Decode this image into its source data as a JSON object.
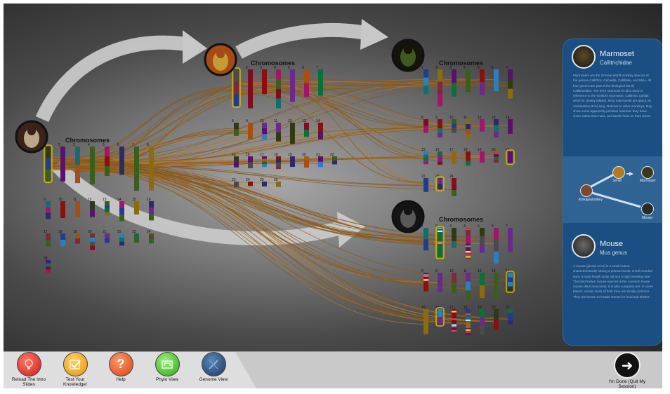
{
  "genomes": [
    {
      "id": "kw",
      "label": "Chromosomes"
    },
    {
      "id": "sw",
      "label": "Chromosomes"
    },
    {
      "id": "mm",
      "label": "Chromosomes"
    },
    {
      "id": "ms",
      "label": "Chromosomes"
    }
  ],
  "panel": {
    "marmoset": {
      "title": "Marmoset",
      "subtitle": "Callitrichidae",
      "text": "Marmosets are the 22 New World monkey species of the genera Callithrix, Cebuella, Callibella, and Mico. All four genera are part of the biological family Callitrichidae. The term marmoset is also used in reference to the Goeldi's marmoset, Callimico goeldii, which is closely related. Most marmosets are about 20 centimetres (8 in) long. Relative to other monkeys, they show some apparently primitive features: they have claws rather than nails, and tactile hairs on their wrists."
    },
    "tree": {
      "root": "Kinkajoutonkey",
      "nodes": [
        "Sirrah",
        "Marmoset",
        "Mouse"
      ]
    },
    "mouse": {
      "title": "Mouse",
      "subtitle": "Mus genus",
      "text": "A mouse (plural: mice) is a small rodent characteristically having a pointed snout, small rounded ears, a body-length scaly tail and a high breeding rate. The best known mouse species is the common house mouse (Mus musculus). It is also a popular pet. In some places, certain kinds of field mice are locally common. They are known to invade homes for food and shelter."
    }
  },
  "toolbar": {
    "reload": "Reload The Intro Slides",
    "test": "Test Your Knowledge!",
    "help": "Help",
    "phylo": "Phylo View",
    "genome": "Genome View",
    "done": "I'm Done (Quit My Session)"
  },
  "colors": {
    "stage_dark": "#262626",
    "panel": "#1b4e82",
    "link": "#8a5a1e",
    "highlight": "#d4b400",
    "reload": "#e8312f",
    "test": "#f2a50c",
    "help": "#e8551d",
    "phylo": "#3fbf2b",
    "genome": "#2a4f7a"
  }
}
